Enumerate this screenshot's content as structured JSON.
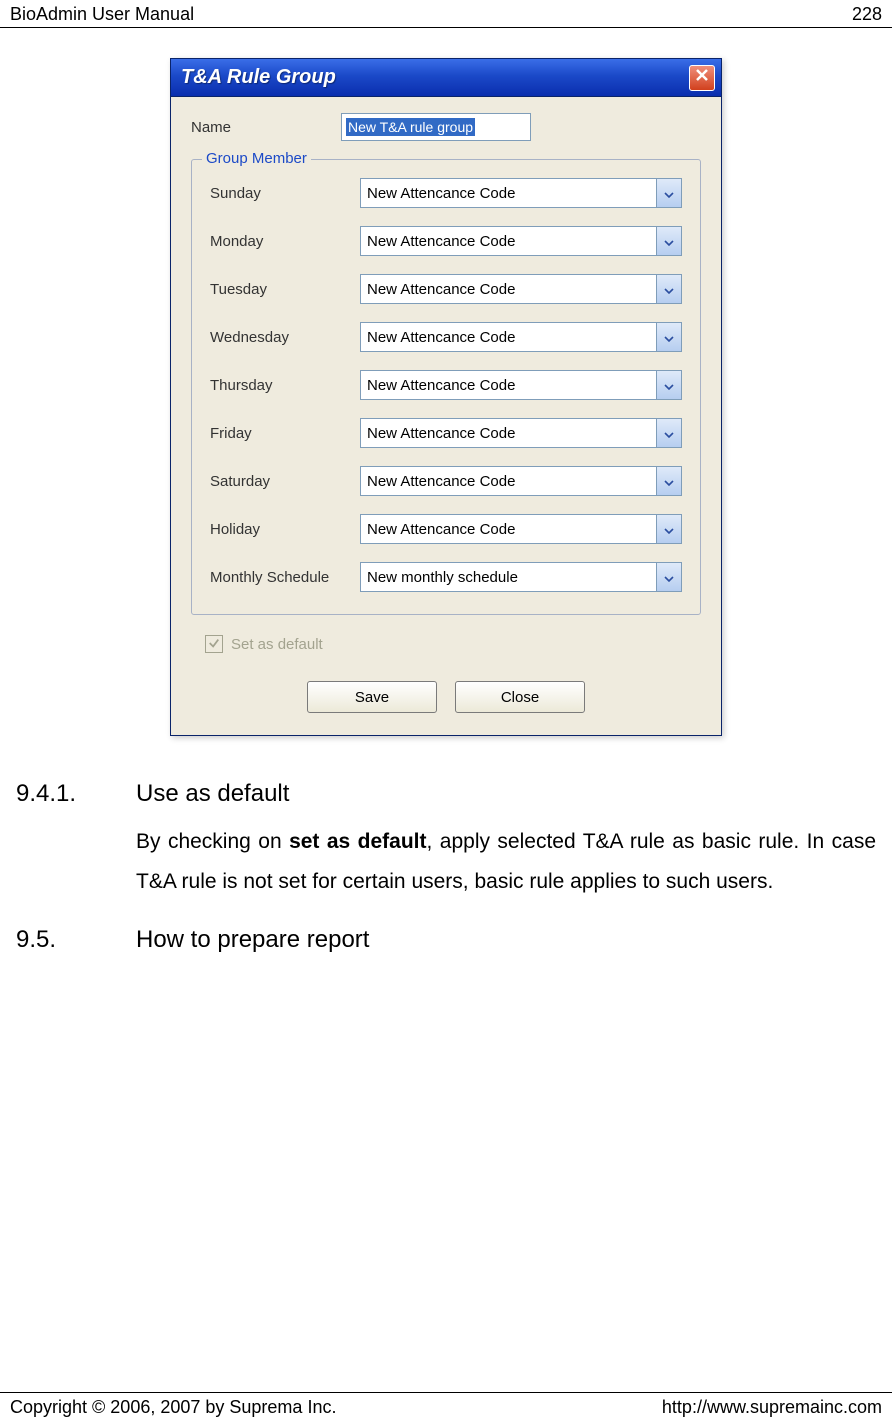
{
  "header": {
    "title": "BioAdmin User Manual",
    "page": "228"
  },
  "dialog": {
    "title": "T&A Rule Group",
    "name_label": "Name",
    "name_value": "New T&A rule group",
    "fieldset_legend": "Group Member",
    "rows": [
      {
        "label": "Sunday",
        "value": "New Attencance Code"
      },
      {
        "label": "Monday",
        "value": "New Attencance Code"
      },
      {
        "label": "Tuesday",
        "value": "New Attencance Code"
      },
      {
        "label": "Wednesday",
        "value": "New Attencance Code"
      },
      {
        "label": "Thursday",
        "value": "New Attencance Code"
      },
      {
        "label": "Friday",
        "value": "New Attencance Code"
      },
      {
        "label": "Saturday",
        "value": "New Attencance Code"
      },
      {
        "label": "Holiday",
        "value": "New Attencance Code"
      },
      {
        "label": "Monthly Schedule",
        "value": "New monthly schedule"
      }
    ],
    "checkbox_label": "Set as default",
    "checkbox_checked": true,
    "buttons": {
      "save": "Save",
      "close": "Close"
    }
  },
  "sections": {
    "s941": {
      "num": "9.4.1.",
      "title": "Use as default",
      "body_pre": "By checking on ",
      "body_bold": "set as default",
      "body_post": ", apply selected T&A rule as basic rule. In case T&A rule is not set for certain users, basic rule applies to such users."
    },
    "s95": {
      "num": "9.5.",
      "title": "How to prepare report"
    }
  },
  "footer": {
    "copyright": "Copyright © 2006, 2007 by Suprema Inc.",
    "url": "http://www.supremainc.com"
  }
}
